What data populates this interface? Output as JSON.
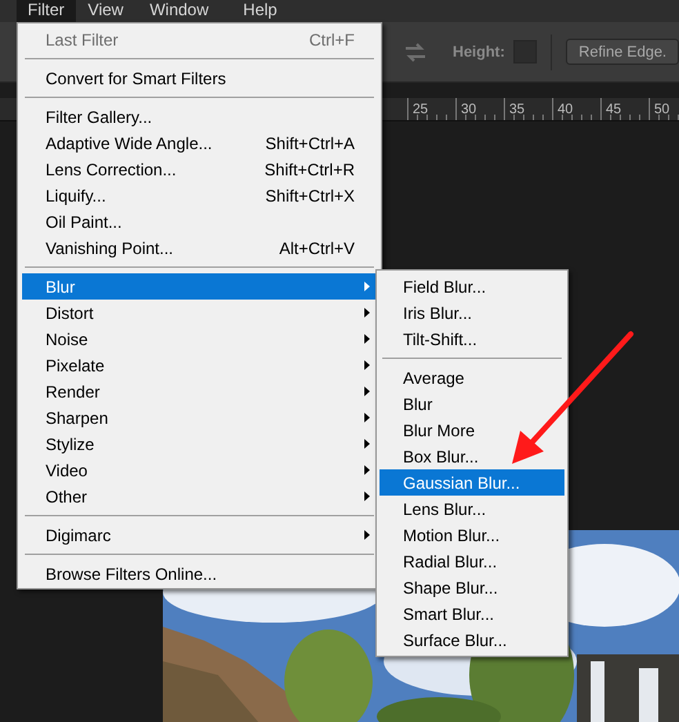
{
  "menubar": [
    {
      "label": "Filter",
      "selected": true
    },
    {
      "label": "View",
      "selected": false
    },
    {
      "label": "Window",
      "selected": false
    },
    {
      "label": "Help",
      "selected": false
    }
  ],
  "options_bar": {
    "height_label": "Height:",
    "refine_button": "Refine Edge."
  },
  "ruler": [
    "25",
    "30",
    "35",
    "40",
    "45",
    "50"
  ],
  "filter_menu": [
    {
      "kind": "item",
      "label": "Last Filter",
      "shortcut": "Ctrl+F",
      "disabled": true,
      "selected": false,
      "submenu": false
    },
    {
      "kind": "separator"
    },
    {
      "kind": "item",
      "label": "Convert for Smart Filters",
      "disabled": false,
      "selected": false,
      "submenu": false
    },
    {
      "kind": "separator"
    },
    {
      "kind": "item",
      "label": "Filter Gallery...",
      "disabled": false,
      "selected": false,
      "submenu": false
    },
    {
      "kind": "item",
      "label": "Adaptive Wide Angle...",
      "shortcut": "Shift+Ctrl+A",
      "disabled": false,
      "selected": false,
      "submenu": false
    },
    {
      "kind": "item",
      "label": "Lens Correction...",
      "shortcut": "Shift+Ctrl+R",
      "disabled": false,
      "selected": false,
      "submenu": false
    },
    {
      "kind": "item",
      "label": "Liquify...",
      "shortcut": "Shift+Ctrl+X",
      "disabled": false,
      "selected": false,
      "submenu": false
    },
    {
      "kind": "item",
      "label": "Oil Paint...",
      "disabled": false,
      "selected": false,
      "submenu": false
    },
    {
      "kind": "item",
      "label": "Vanishing Point...",
      "shortcut": "Alt+Ctrl+V",
      "disabled": false,
      "selected": false,
      "submenu": false
    },
    {
      "kind": "separator"
    },
    {
      "kind": "item",
      "label": "Blur",
      "disabled": false,
      "selected": true,
      "submenu": true
    },
    {
      "kind": "item",
      "label": "Distort",
      "disabled": false,
      "selected": false,
      "submenu": true
    },
    {
      "kind": "item",
      "label": "Noise",
      "disabled": false,
      "selected": false,
      "submenu": true
    },
    {
      "kind": "item",
      "label": "Pixelate",
      "disabled": false,
      "selected": false,
      "submenu": true
    },
    {
      "kind": "item",
      "label": "Render",
      "disabled": false,
      "selected": false,
      "submenu": true
    },
    {
      "kind": "item",
      "label": "Sharpen",
      "disabled": false,
      "selected": false,
      "submenu": true
    },
    {
      "kind": "item",
      "label": "Stylize",
      "disabled": false,
      "selected": false,
      "submenu": true
    },
    {
      "kind": "item",
      "label": "Video",
      "disabled": false,
      "selected": false,
      "submenu": true
    },
    {
      "kind": "item",
      "label": "Other",
      "disabled": false,
      "selected": false,
      "submenu": true
    },
    {
      "kind": "separator"
    },
    {
      "kind": "item",
      "label": "Digimarc",
      "disabled": false,
      "selected": false,
      "submenu": true
    },
    {
      "kind": "separator"
    },
    {
      "kind": "item",
      "label": "Browse Filters Online...",
      "disabled": false,
      "selected": false,
      "submenu": false
    }
  ],
  "blur_submenu": [
    {
      "kind": "item",
      "label": "Field Blur...",
      "disabled": false,
      "selected": false,
      "submenu": false
    },
    {
      "kind": "item",
      "label": "Iris Blur...",
      "disabled": false,
      "selected": false,
      "submenu": false
    },
    {
      "kind": "item",
      "label": "Tilt-Shift...",
      "disabled": false,
      "selected": false,
      "submenu": false
    },
    {
      "kind": "separator"
    },
    {
      "kind": "item",
      "label": "Average",
      "disabled": false,
      "selected": false,
      "submenu": false
    },
    {
      "kind": "item",
      "label": "Blur",
      "disabled": false,
      "selected": false,
      "submenu": false
    },
    {
      "kind": "item",
      "label": "Blur More",
      "disabled": false,
      "selected": false,
      "submenu": false
    },
    {
      "kind": "item",
      "label": "Box Blur...",
      "disabled": false,
      "selected": false,
      "submenu": false
    },
    {
      "kind": "item",
      "label": "Gaussian Blur...",
      "disabled": false,
      "selected": true,
      "submenu": false
    },
    {
      "kind": "item",
      "label": "Lens Blur...",
      "disabled": false,
      "selected": false,
      "submenu": false
    },
    {
      "kind": "item",
      "label": "Motion Blur...",
      "disabled": false,
      "selected": false,
      "submenu": false
    },
    {
      "kind": "item",
      "label": "Radial Blur...",
      "disabled": false,
      "selected": false,
      "submenu": false
    },
    {
      "kind": "item",
      "label": "Shape Blur...",
      "disabled": false,
      "selected": false,
      "submenu": false
    },
    {
      "kind": "item",
      "label": "Smart Blur...",
      "disabled": false,
      "selected": false,
      "submenu": false
    },
    {
      "kind": "item",
      "label": "Surface Blur...",
      "disabled": false,
      "selected": false,
      "submenu": false
    }
  ]
}
